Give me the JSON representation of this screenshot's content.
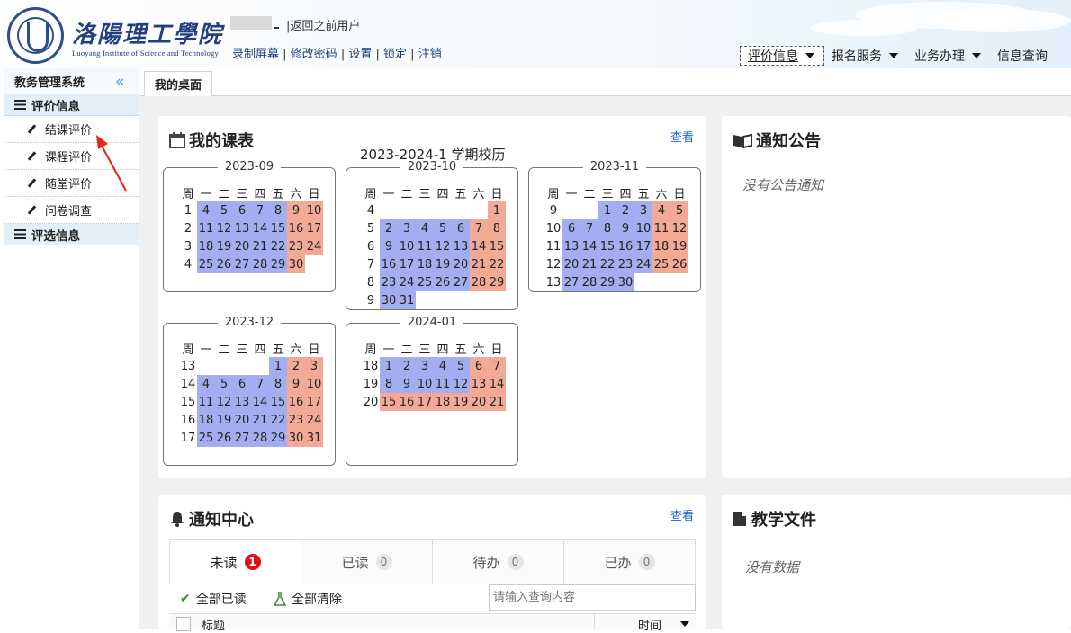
{
  "header": {
    "school_cn": "洛陽理工學院",
    "school_en": "Luoyang Institute of Science and Technology",
    "back_link": "|返回之前用户",
    "links": [
      "录制屏幕",
      "修改密码",
      "设置",
      "锁定",
      "注销"
    ],
    "nav": [
      {
        "label": "评价信息",
        "selected": true
      },
      {
        "label": "报名服务",
        "selected": false
      },
      {
        "label": "业务办理",
        "selected": false
      },
      {
        "label": "信息查询",
        "selected": false
      }
    ]
  },
  "sidebar": {
    "title": "教务管理系统",
    "collapse_icon": "«",
    "section1": "评价信息",
    "items": [
      "结课评价",
      "课程评价",
      "随堂评价",
      "问卷调查"
    ],
    "section2": "评选信息"
  },
  "tabs": {
    "home": "我的桌面"
  },
  "schedule": {
    "title": "我的课表",
    "more": "查看",
    "calendar_title": "2023-2024-1 学期校历",
    "header_row": [
      "周",
      "一",
      "二",
      "三",
      "四",
      "五",
      "六",
      "日"
    ],
    "months": [
      {
        "name": "2023-09",
        "rows": [
          {
            "week": "1",
            "days": [
              "",
              "",
              "",
              "",
              "",
              "",
              "",
              ""
            ],
            "cells": [
              "4",
              "5",
              "6",
              "7",
              "8",
              "9",
              "10"
            ],
            "types": [
              "w",
              "w",
              "w",
              "w",
              "w",
              "r",
              "r"
            ]
          },
          {
            "week": "2",
            "cells": [
              "11",
              "12",
              "13",
              "14",
              "15",
              "16",
              "17"
            ],
            "types": [
              "w",
              "w",
              "w",
              "w",
              "w",
              "r",
              "r"
            ]
          },
          {
            "week": "3",
            "cells": [
              "18",
              "19",
              "20",
              "21",
              "22",
              "23",
              "24"
            ],
            "types": [
              "w",
              "w",
              "w",
              "w",
              "w",
              "r",
              "r"
            ]
          },
          {
            "week": "4",
            "cells": [
              "25",
              "26",
              "27",
              "28",
              "29",
              "30",
              ""
            ],
            "types": [
              "w",
              "w",
              "w",
              "w",
              "w",
              "r",
              ""
            ]
          }
        ]
      },
      {
        "name": "2023-10",
        "rows": [
          {
            "week": "4",
            "cells": [
              "",
              "",
              "",
              "",
              "",
              "",
              "1"
            ],
            "types": [
              "",
              "",
              "",
              "",
              "",
              "",
              "r"
            ]
          },
          {
            "week": "5",
            "cells": [
              "2",
              "3",
              "4",
              "5",
              "6",
              "7",
              "8"
            ],
            "types": [
              "w",
              "w",
              "w",
              "w",
              "w",
              "r",
              "r"
            ]
          },
          {
            "week": "6",
            "cells": [
              "9",
              "10",
              "11",
              "12",
              "13",
              "14",
              "15"
            ],
            "types": [
              "w",
              "w",
              "w",
              "w",
              "w",
              "r",
              "r"
            ]
          },
          {
            "week": "7",
            "cells": [
              "16",
              "17",
              "18",
              "19",
              "20",
              "21",
              "22"
            ],
            "types": [
              "w",
              "w",
              "w",
              "w",
              "w",
              "r",
              "r"
            ]
          },
          {
            "week": "8",
            "cells": [
              "23",
              "24",
              "25",
              "26",
              "27",
              "28",
              "29"
            ],
            "types": [
              "w",
              "w",
              "w",
              "w",
              "w",
              "r",
              "r"
            ]
          },
          {
            "week": "9",
            "cells": [
              "30",
              "31",
              "",
              "",
              "",
              "",
              ""
            ],
            "types": [
              "w",
              "w",
              "",
              "",
              "",
              "",
              ""
            ]
          }
        ]
      },
      {
        "name": "2023-11",
        "rows": [
          {
            "week": "9",
            "cells": [
              "",
              "",
              "1",
              "2",
              "3",
              "4",
              "5"
            ],
            "types": [
              "",
              "",
              "w",
              "w",
              "w",
              "r",
              "r"
            ]
          },
          {
            "week": "10",
            "cells": [
              "6",
              "7",
              "8",
              "9",
              "10",
              "11",
              "12"
            ],
            "types": [
              "w",
              "w",
              "w",
              "w",
              "w",
              "r",
              "r"
            ]
          },
          {
            "week": "11",
            "cells": [
              "13",
              "14",
              "15",
              "16",
              "17",
              "18",
              "19"
            ],
            "types": [
              "w",
              "w",
              "w",
              "w",
              "w",
              "r",
              "r"
            ]
          },
          {
            "week": "12",
            "cells": [
              "20",
              "21",
              "22",
              "23",
              "24",
              "25",
              "26"
            ],
            "types": [
              "w",
              "w",
              "w",
              "w",
              "w",
              "r",
              "r"
            ]
          },
          {
            "week": "13",
            "cells": [
              "27",
              "28",
              "29",
              "30",
              "",
              "",
              ""
            ],
            "types": [
              "w",
              "w",
              "w",
              "w",
              "",
              "",
              ""
            ]
          }
        ]
      },
      {
        "name": "2023-12",
        "rows": [
          {
            "week": "13",
            "cells": [
              "",
              "",
              "",
              "",
              "1",
              "2",
              "3"
            ],
            "types": [
              "",
              "",
              "",
              "",
              "w",
              "r",
              "r"
            ]
          },
          {
            "week": "14",
            "cells": [
              "4",
              "5",
              "6",
              "7",
              "8",
              "9",
              "10"
            ],
            "types": [
              "w",
              "w",
              "w",
              "w",
              "w",
              "r",
              "r"
            ]
          },
          {
            "week": "15",
            "cells": [
              "11",
              "12",
              "13",
              "14",
              "15",
              "16",
              "17"
            ],
            "types": [
              "w",
              "w",
              "w",
              "w",
              "w",
              "r",
              "r"
            ]
          },
          {
            "week": "16",
            "cells": [
              "18",
              "19",
              "20",
              "21",
              "22",
              "23",
              "24"
            ],
            "types": [
              "w",
              "w",
              "w",
              "w",
              "w",
              "r",
              "r"
            ]
          },
          {
            "week": "17",
            "cells": [
              "25",
              "26",
              "27",
              "28",
              "29",
              "30",
              "31"
            ],
            "types": [
              "w",
              "w",
              "w",
              "w",
              "w",
              "r",
              "r"
            ]
          }
        ]
      },
      {
        "name": "2024-01",
        "rows": [
          {
            "week": "18",
            "cells": [
              "1",
              "2",
              "3",
              "4",
              "5",
              "6",
              "7"
            ],
            "types": [
              "w",
              "w",
              "w",
              "w",
              "w",
              "r",
              "r"
            ]
          },
          {
            "week": "19",
            "cells": [
              "8",
              "9",
              "10",
              "11",
              "12",
              "13",
              "14"
            ],
            "types": [
              "w",
              "w",
              "w",
              "w",
              "w",
              "r",
              "r"
            ]
          },
          {
            "week": "20",
            "cells": [
              "15",
              "16",
              "17",
              "18",
              "19",
              "20",
              "21"
            ],
            "types": [
              "r",
              "r",
              "r",
              "r",
              "r",
              "r",
              "r"
            ]
          }
        ]
      }
    ]
  },
  "notice": {
    "title": "通知公告",
    "empty": "没有公告通知"
  },
  "notify_center": {
    "title": "通知中心",
    "more": "查看",
    "tabs": [
      {
        "label": "未读",
        "count": "1"
      },
      {
        "label": "已读",
        "count": "0"
      },
      {
        "label": "待办",
        "count": "0"
      },
      {
        "label": "已办",
        "count": "0"
      }
    ],
    "mark_all": "全部已读",
    "clear_all": "全部清除",
    "search_placeholder": "请输入查询内容",
    "col_title": "标题",
    "col_time": "时间"
  },
  "teaching_files": {
    "title": "教学文件",
    "empty": "没有数据"
  },
  "colors": {
    "weekday": "#a3aef0",
    "weekend": "#f2a996",
    "badge_red": "#e10d1a",
    "link": "#1f63c7",
    "annotation_arrow": "#e8231a"
  }
}
